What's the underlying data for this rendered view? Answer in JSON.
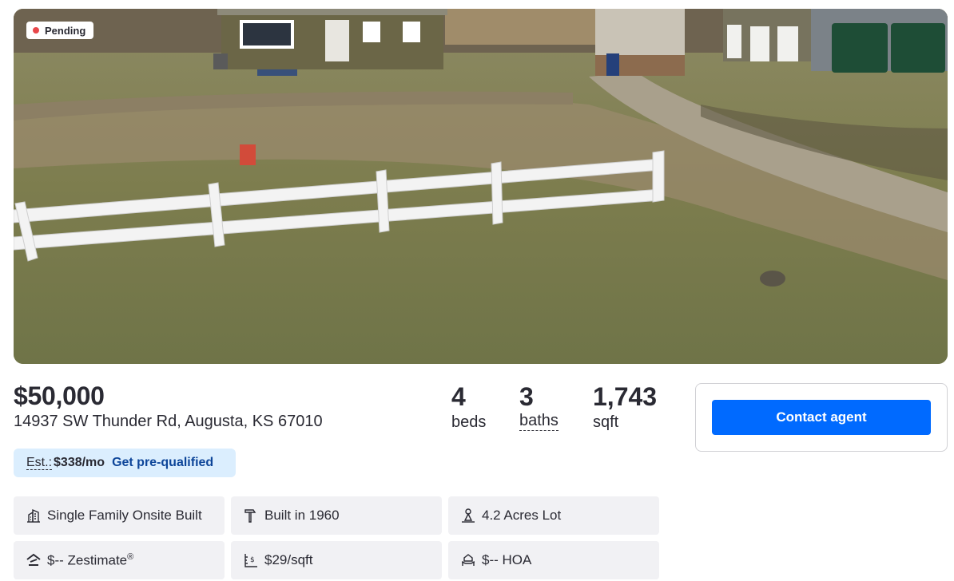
{
  "photo": {
    "status": "Pending",
    "status_color": "#e8474a"
  },
  "listing": {
    "price": "$50,000",
    "address": "14937 SW Thunder Rd, Augusta, KS 67010"
  },
  "stats": [
    {
      "value": "4",
      "label": "beds"
    },
    {
      "value": "3",
      "label": "baths"
    },
    {
      "value": "1,743",
      "label": "sqft"
    }
  ],
  "estimate": {
    "label": "Est.:",
    "amount": "$338/mo",
    "link": "Get pre-qualified"
  },
  "facts": [
    {
      "icon": "building-icon",
      "text": "Single Family Onsite Built"
    },
    {
      "icon": "hammer-icon",
      "text": "Built in 1960"
    },
    {
      "icon": "lot-size-icon",
      "text": "4.2 Acres Lot"
    },
    {
      "icon": "zestimate-icon",
      "text": "$-- Zestimate",
      "sup": "®"
    },
    {
      "icon": "price-per-sqft-icon",
      "text": "$29/sqft"
    },
    {
      "icon": "hoa-icon",
      "text": "$-- HOA"
    }
  ],
  "agent": {
    "contact_label": "Contact agent"
  },
  "colors": {
    "accent": "#006aff",
    "link": "#0d4599",
    "estimate_bg": "#dbeefe",
    "fact_bg": "#f1f1f4"
  }
}
